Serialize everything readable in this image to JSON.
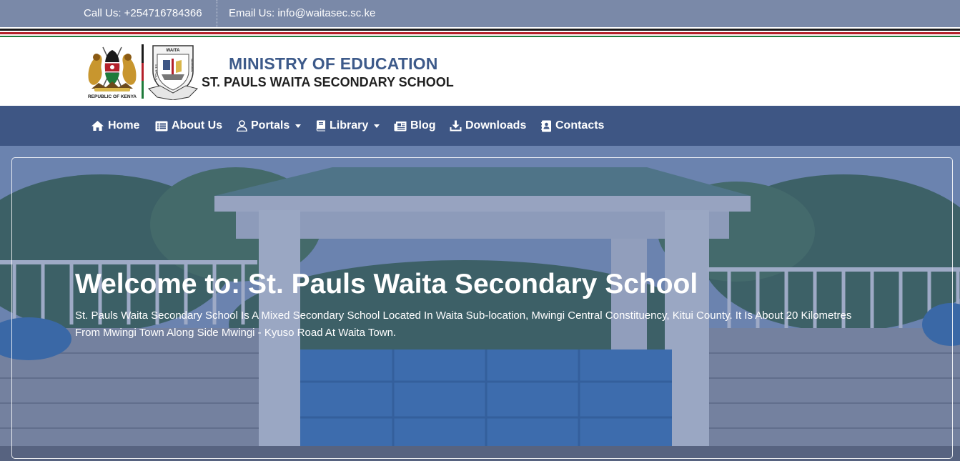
{
  "topbar": {
    "call": "Call Us: +254716784366",
    "email": "Email Us: info@waitasec.sc.ke"
  },
  "header": {
    "ministry": "MINISTRY OF EDUCATION",
    "school": "ST. PAULS WAITA SECONDARY SCHOOL",
    "coat_caption": "REPUBLIC OF KENYA",
    "crest_text": "WAITA",
    "crest_side_left": "ST. PAULS",
    "crest_side_right": "SCHOOL"
  },
  "nav": {
    "items": [
      {
        "label": "Home",
        "icon": "home-icon"
      },
      {
        "label": "About Us",
        "icon": "list-icon"
      },
      {
        "label": "Portals",
        "icon": "user-icon",
        "dropdown": true
      },
      {
        "label": "Library",
        "icon": "book-icon",
        "dropdown": true
      },
      {
        "label": "Blog",
        "icon": "newspaper-icon"
      },
      {
        "label": "Downloads",
        "icon": "download-icon"
      },
      {
        "label": "Contacts",
        "icon": "contact-book-icon"
      }
    ]
  },
  "hero": {
    "title": "Welcome to: St. Pauls Waita Secondary School",
    "description": "St. Pauls Waita Secondary School Is A Mixed Secondary School Located In Waita Sub-location, Mwingi Central Constituency, Kitui County. It Is About 20 Kilometres From Mwingi Town Along Side Mwingi - Kyuso Road At Waita Town."
  },
  "colors": {
    "topbar": "#7a89a8",
    "nav": "#3e5684",
    "ministry_text": "#3d5a8a",
    "flag_black": "#1a1a1a",
    "flag_red": "#b3202a",
    "flag_green": "#1f7a3a"
  }
}
